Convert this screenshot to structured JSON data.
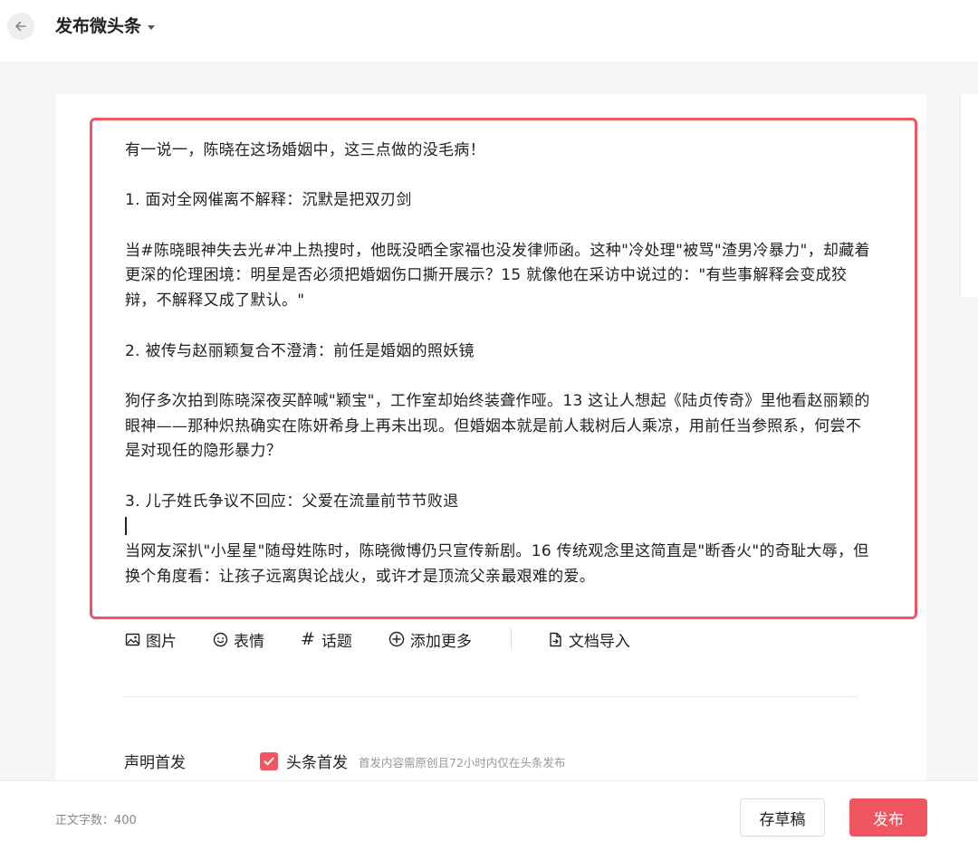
{
  "header": {
    "title": "发布微头条"
  },
  "editor": {
    "paragraphs": [
      "有一说一，陈晓在这场婚姻中，这三点做的没毛病！",
      "1. 面对全网催离不解释：沉默是把双刃剑",
      "当#陈晓眼神失去光#冲上热搜时，他既没晒全家福也没发律师函。这种\"冷处理\"被骂\"渣男冷暴力\"，却藏着更深的伦理困境：明星是否必须把婚姻伤口撕开展示？15 就像他在采访中说过的：\"有些事解释会变成狡辩，不解释又成了默认。\"",
      "2. 被传与赵丽颖复合不澄清：前任是婚姻的照妖镜",
      "狗仔多次拍到陈晓深夜买醉喊\"颖宝\"，工作室却始终装聋作哑。13 这让人想起《陆贞传奇》里他看赵丽颖的眼神——那种炽热确实在陈妍希身上再未出现。但婚姻本就是前人栽树后人乘凉，用前任当参照系，何尝不是对现任的隐形暴力？",
      "3. 儿子姓氏争议不回应：父爱在流量前节节败退",
      "当网友深扒\"小星星\"随母姓陈时，陈晓微博仍只宣传新剧。16 传统观念里这简直是\"断香火\"的奇耻大辱，但换个角度看：让孩子远离舆论战火，或许才是顶流父亲最艰难的爱。"
    ]
  },
  "toolbar": {
    "image_label": "图片",
    "emoji_label": "表情",
    "topic_label": "话题",
    "more_label": "添加更多",
    "import_label": "文档导入"
  },
  "declare": {
    "label": "声明首发",
    "checkbox_label": "头条首发",
    "checked": true,
    "hint": "首发内容需原创且72小时内仅在头条发布"
  },
  "footer": {
    "word_count": "正文字数：400",
    "draft_label": "存草稿",
    "publish_label": "发布"
  },
  "colors": {
    "accent": "#f0565f"
  },
  "icons": {
    "back": "arrow-left-icon",
    "image": "image-icon",
    "emoji": "smile-icon",
    "topic": "hash-icon",
    "more": "plus-circle-icon",
    "import": "document-import-icon",
    "check": "check-icon"
  }
}
